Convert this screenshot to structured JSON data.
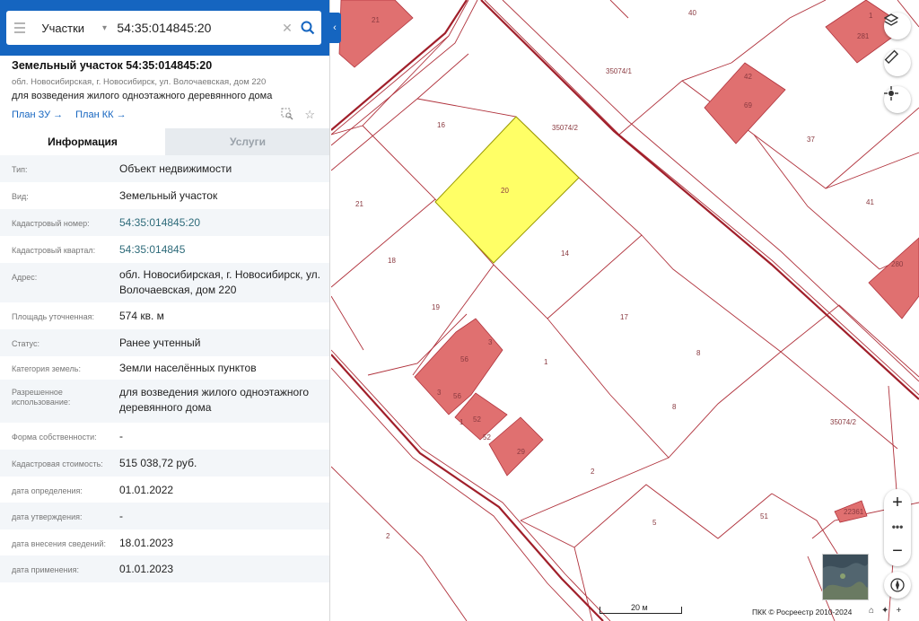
{
  "search": {
    "type_label": "Участки",
    "query": "54:35:014845:20"
  },
  "card": {
    "title": "Земельный участок 54:35:014845:20",
    "address": "обл. Новосибирская, г. Новосибирск, ул. Волочаевская, дом 220",
    "purpose": "для возведения жилого одноэтажного деревянного дома",
    "link_plan_zu": "План ЗУ →",
    "link_plan_kk": "План КК →"
  },
  "tabs": {
    "info": "Информация",
    "services": "Услуги"
  },
  "details": {
    "type_label": "Тип:",
    "type_value": "Объект недвижимости",
    "kind_label": "Вид:",
    "kind_value": "Земельный участок",
    "cad_num_label": "Кадастровый номер:",
    "cad_num_value": "54:35:014845:20",
    "cad_quarter_label": "Кадастровый квартал:",
    "cad_quarter_value": "54:35:014845",
    "address_label": "Адрес:",
    "address_value": "обл. Новосибирская, г. Новосибирск, ул. Волочаевская, дом 220",
    "area_label": "Площадь уточненная:",
    "area_value": "574 кв. м",
    "status_label": "Статус:",
    "status_value": "Ранее учтенный",
    "category_label": "Категория земель:",
    "category_value": "Земли населённых пунктов",
    "permitted_label": "Разрешенное использование:",
    "permitted_value": "для возведения жилого одноэтажного деревянного дома",
    "ownership_label": "Форма собственности:",
    "ownership_value": "-",
    "cost_label": "Кадастровая стоимость:",
    "cost_value": "515 038,72 руб.",
    "def_date_label": "дата определения:",
    "def_date_value": "01.01.2022",
    "approve_date_label": "дата утверждения:",
    "approve_date_value": "-",
    "entry_date_label": "дата внесения сведений:",
    "entry_date_value": "18.01.2023",
    "apply_date_label": "дата применения:",
    "apply_date_value": "01.01.2023"
  },
  "map": {
    "plot_labels": {
      "p21top": "21",
      "p40": "40",
      "p1": "1",
      "p281": "281",
      "q35074_1": "35074/1",
      "p42": "42",
      "p69": "69",
      "p16": "16",
      "q35074_2a": "35074/2",
      "p37": "37",
      "p20": "20",
      "p21": "21",
      "p41": "41",
      "p18": "18",
      "p14": "14",
      "p280": "280",
      "p19": "19",
      "p17": "17",
      "p3": "3",
      "p56": "56",
      "p1b": "1",
      "p8a": "8",
      "p3b": "3",
      "p56b": "56",
      "p8b": "8",
      "p1c": "1",
      "p52": "52",
      "p52b": "52",
      "q35074_2b": "35074/2",
      "p29": "29",
      "p2a": "2",
      "p5": "5",
      "p51": "51",
      "p2b": "2",
      "q22361": "22361"
    },
    "scale": "20 м",
    "copyright": "ПКК © Росреестр 2010-2024",
    "colors": {
      "boundary": "#b0323c",
      "building": "#e07070",
      "selected": "#ffff66",
      "accent": "#1565c0"
    }
  }
}
